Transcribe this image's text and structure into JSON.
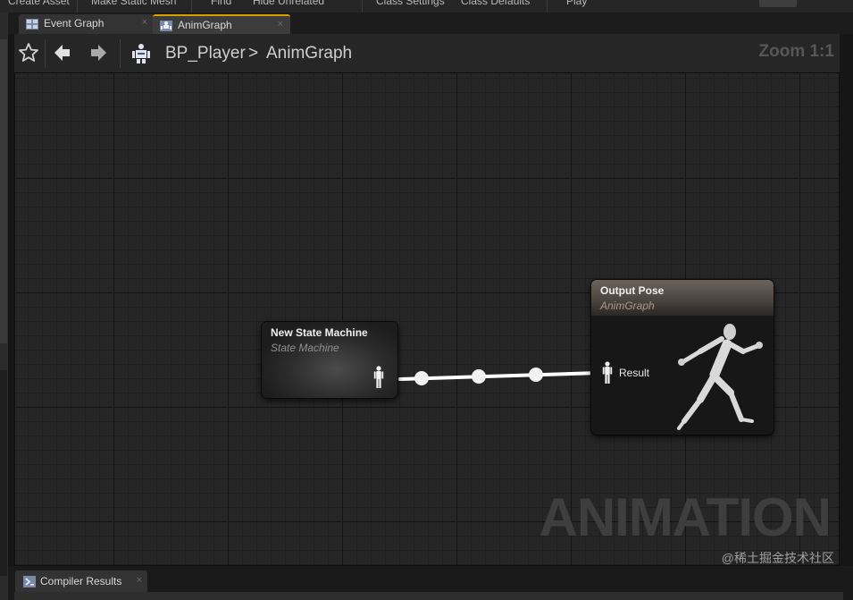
{
  "toolbar": {
    "items": [
      "Create Asset",
      "Make Static Mesh",
      "Find",
      "Hide Unrelated",
      "Class Settings",
      "Class Defaults",
      "Play"
    ]
  },
  "tabs": [
    {
      "label": "Event Graph",
      "close": "×",
      "icon": "event-graph-icon"
    },
    {
      "label": "AnimGraph",
      "close": "×",
      "icon": "anim-graph-icon",
      "active": true
    }
  ],
  "breadcrumb": {
    "blueprint": "BP_Player",
    "separator": ">",
    "graph": "AnimGraph",
    "zoom": "Zoom 1:1"
  },
  "nodes": {
    "state_machine": {
      "title": "New State Machine",
      "subtitle": "State Machine"
    },
    "output_pose": {
      "title": "Output Pose",
      "subtitle": "AnimGraph",
      "pin_label": "Result"
    }
  },
  "watermark": "ANIMATION",
  "credit": "@稀土掘金技术社区",
  "bottom_tab": {
    "label": "Compiler Results",
    "close": "×",
    "icon": "compiler-results-icon"
  },
  "colors": {
    "accent_tab": "#d6a000",
    "wire": "#ffffff",
    "canvas": "#262626",
    "output_header": "#6b625b"
  }
}
